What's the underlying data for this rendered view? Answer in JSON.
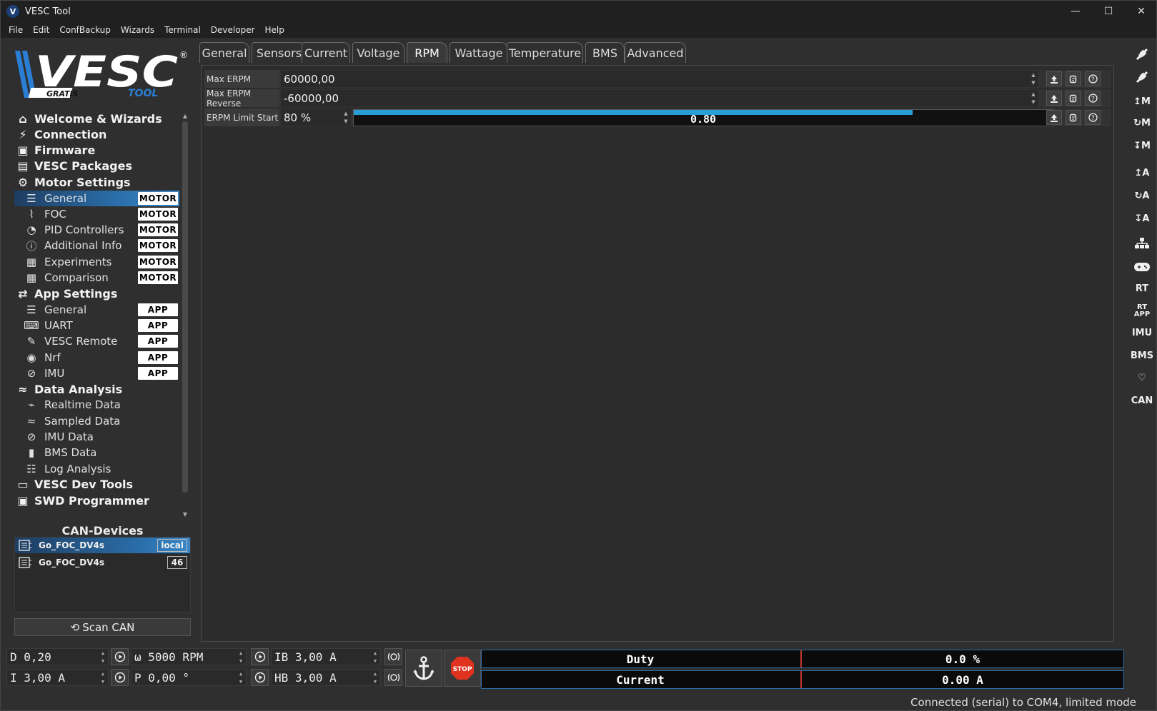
{
  "window": {
    "title": "VESC Tool",
    "icon_letter": "V",
    "minimize": "—",
    "maximize": "☐",
    "close": "✕"
  },
  "menu": [
    "File",
    "Edit",
    "ConfBackup",
    "Wizards",
    "Terminal",
    "Developer",
    "Help"
  ],
  "logo": {
    "main": "VESC",
    "reg": "®",
    "gratis": "GRATIS",
    "tool": "TOOL"
  },
  "nav": [
    {
      "label": "Welcome & Wizards",
      "level": "h",
      "icon": "home-icon"
    },
    {
      "label": "Connection",
      "level": "h",
      "icon": "plug-icon"
    },
    {
      "label": "Firmware",
      "level": "h",
      "icon": "chip-icon"
    },
    {
      "label": "VESC Packages",
      "level": "h",
      "icon": "package-icon"
    },
    {
      "label": "Motor Settings",
      "level": "h",
      "icon": "motor-icon"
    },
    {
      "label": "General",
      "level": "s",
      "icon": "sliders-icon",
      "badge": "MOTOR",
      "selected": true
    },
    {
      "label": "FOC",
      "level": "s",
      "icon": "coil-icon",
      "badge": "MOTOR"
    },
    {
      "label": "PID Controllers",
      "level": "s",
      "icon": "gauge-icon",
      "badge": "MOTOR"
    },
    {
      "label": "Additional Info",
      "level": "s",
      "icon": "info-icon",
      "badge": "MOTOR"
    },
    {
      "label": "Experiments",
      "level": "s",
      "icon": "calculator-icon",
      "badge": "MOTOR"
    },
    {
      "label": "Comparison",
      "level": "s",
      "icon": "calculator-icon",
      "badge": "MOTOR"
    },
    {
      "label": "App Settings",
      "level": "h",
      "icon": "arrows-icon"
    },
    {
      "label": "General",
      "level": "s",
      "icon": "sliders-icon",
      "badge": "APP"
    },
    {
      "label": "UART",
      "level": "s",
      "icon": "keyboard-icon",
      "badge": "APP"
    },
    {
      "label": "VESC Remote",
      "level": "s",
      "icon": "remote-icon",
      "badge": "APP"
    },
    {
      "label": "Nrf",
      "level": "s",
      "icon": "wireless-icon",
      "badge": "APP"
    },
    {
      "label": "IMU",
      "level": "s",
      "icon": "imu-icon",
      "badge": "APP"
    },
    {
      "label": "Data Analysis",
      "level": "h",
      "icon": "chart-icon"
    },
    {
      "label": "Realtime Data",
      "level": "s",
      "icon": "realtime-icon"
    },
    {
      "label": "Sampled Data",
      "level": "s",
      "icon": "chart-icon"
    },
    {
      "label": "IMU Data",
      "level": "s",
      "icon": "imu-icon"
    },
    {
      "label": "BMS Data",
      "level": "s",
      "icon": "battery-icon"
    },
    {
      "label": "Log Analysis",
      "level": "s",
      "icon": "log-icon"
    },
    {
      "label": "VESC Dev Tools",
      "level": "h",
      "icon": "terminal-icon"
    },
    {
      "label": "SWD Programmer",
      "level": "h",
      "icon": "chip-icon"
    }
  ],
  "can": {
    "title": "CAN-Devices",
    "devices": [
      {
        "name": "Go_FOC_DV4s",
        "badge": "local",
        "selected": true
      },
      {
        "name": "Go_FOC_DV4s",
        "badge": "46",
        "selected": false
      }
    ],
    "scan_label": "Scan CAN"
  },
  "tabs": [
    {
      "label": "General",
      "active": false
    },
    {
      "label": "Sensors",
      "active": false
    },
    {
      "label": "Current",
      "active": false
    },
    {
      "label": "Voltage",
      "active": false
    },
    {
      "label": "RPM",
      "active": true
    },
    {
      "label": "Wattage",
      "active": false
    },
    {
      "label": "Temperature",
      "active": false
    },
    {
      "label": "BMS",
      "active": false
    },
    {
      "label": "Advanced",
      "active": false
    }
  ],
  "params": [
    {
      "label": "Max ERPM",
      "value": "60000,00"
    },
    {
      "label": "Max ERPM Reverse",
      "value": "-60000,00"
    },
    {
      "label": "ERPM Limit Start",
      "value": "80 %",
      "bar_text": "0.80",
      "bar_fraction": 0.8
    }
  ],
  "right_toolbar": [
    {
      "icon": "connect-icon",
      "text": ""
    },
    {
      "icon": "disconnect-icon",
      "text": ""
    },
    {
      "icon": "write-motor-icon",
      "text": "↥M"
    },
    {
      "icon": "read-motor-icon",
      "text": "↻M"
    },
    {
      "icon": "read-default-motor-icon",
      "text": "↧M"
    },
    {
      "icon": "write-app-icon",
      "text": "↥A"
    },
    {
      "icon": "read-app-icon",
      "text": "↻A"
    },
    {
      "icon": "read-default-app-icon",
      "text": "↧A"
    },
    {
      "icon": "can-fwd-icon",
      "text": ""
    },
    {
      "icon": "gamepad-icon",
      "text": ""
    },
    {
      "icon": "rt-icon",
      "text": "RT"
    },
    {
      "icon": "rt-app-icon",
      "text": "RT APP"
    },
    {
      "icon": "imu-stream-icon",
      "text": "IMU"
    },
    {
      "icon": "bms-stream-icon",
      "text": "BMS"
    },
    {
      "icon": "heart-icon",
      "text": "♡"
    },
    {
      "icon": "can-icon",
      "text": "CAN"
    }
  ],
  "controls": {
    "duty": "D 0,20",
    "rpm": "ω 5000 RPM",
    "ib": "IB 3,00 A",
    "current": "I 3,00 A",
    "position": "P 0,00 °",
    "hb": "HB 3,00 A",
    "stop_label": "STOP"
  },
  "gauges": [
    {
      "label": "Duty",
      "value": "0.0 %"
    },
    {
      "label": "Current",
      "value": "0.00 A"
    }
  ],
  "status": "Connected (serial) to COM4, limited mode",
  "colors": {
    "accent": "#2a9fd6",
    "selection": "#2a6da8",
    "stop": "#e0321e"
  }
}
